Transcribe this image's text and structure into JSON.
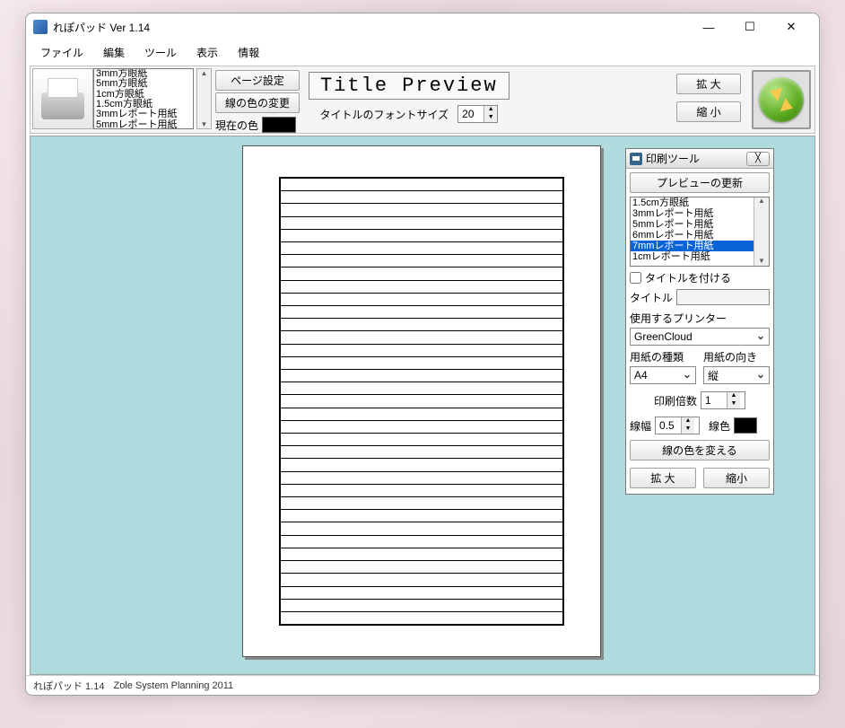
{
  "titlebar": {
    "title": "れぽパッド  Ver 1.14"
  },
  "menubar": {
    "items": [
      "ファイル",
      "編集",
      "ツール",
      "表示",
      "情報"
    ]
  },
  "toolbar": {
    "paper_list": [
      "3mm方眼紙",
      "5mm方眼紙",
      "1cm方眼紙",
      "1.5cm方眼紙",
      "3mmレポート用紙",
      "5mmレポート用紙"
    ],
    "page_setup": "ページ設定",
    "line_color_change": "線の色の変更",
    "current_color_label": "現在の色",
    "title_preview": "Title Preview",
    "font_size_label": "タイトルのフォントサイズ",
    "font_size_value": "20",
    "zoom_in": "拡 大",
    "zoom_out": "縮 小"
  },
  "tool": {
    "title": "印刷ツール",
    "refresh_preview": "プレビューの更新",
    "list_items": [
      "1.5cm方眼紙",
      "3mmレポート用紙",
      "5mmレポート用紙",
      "6mmレポート用紙",
      "7mmレポート用紙",
      "1cmレポート用紙"
    ],
    "selected_index": 4,
    "add_title_label": "タイトルを付ける",
    "title_label": "タイトル",
    "title_value": "",
    "printer_label": "使用するプリンター",
    "printer_value": "GreenCloud",
    "paper_type_label": "用紙の種類",
    "paper_type_value": "A4",
    "orientation_label": "用紙の向き",
    "orientation_value": "縦",
    "copies_label": "印刷倍数",
    "copies_value": "1",
    "line_width_label": "線幅",
    "line_width_value": "0.5",
    "line_color_label": "線色",
    "change_line_color": "線の色を変える",
    "zoom_in": "拡 大",
    "zoom_out": "縮小"
  },
  "statusbar": {
    "app": "れぽパッド 1.14",
    "company": "Zole System Planning  2011"
  }
}
